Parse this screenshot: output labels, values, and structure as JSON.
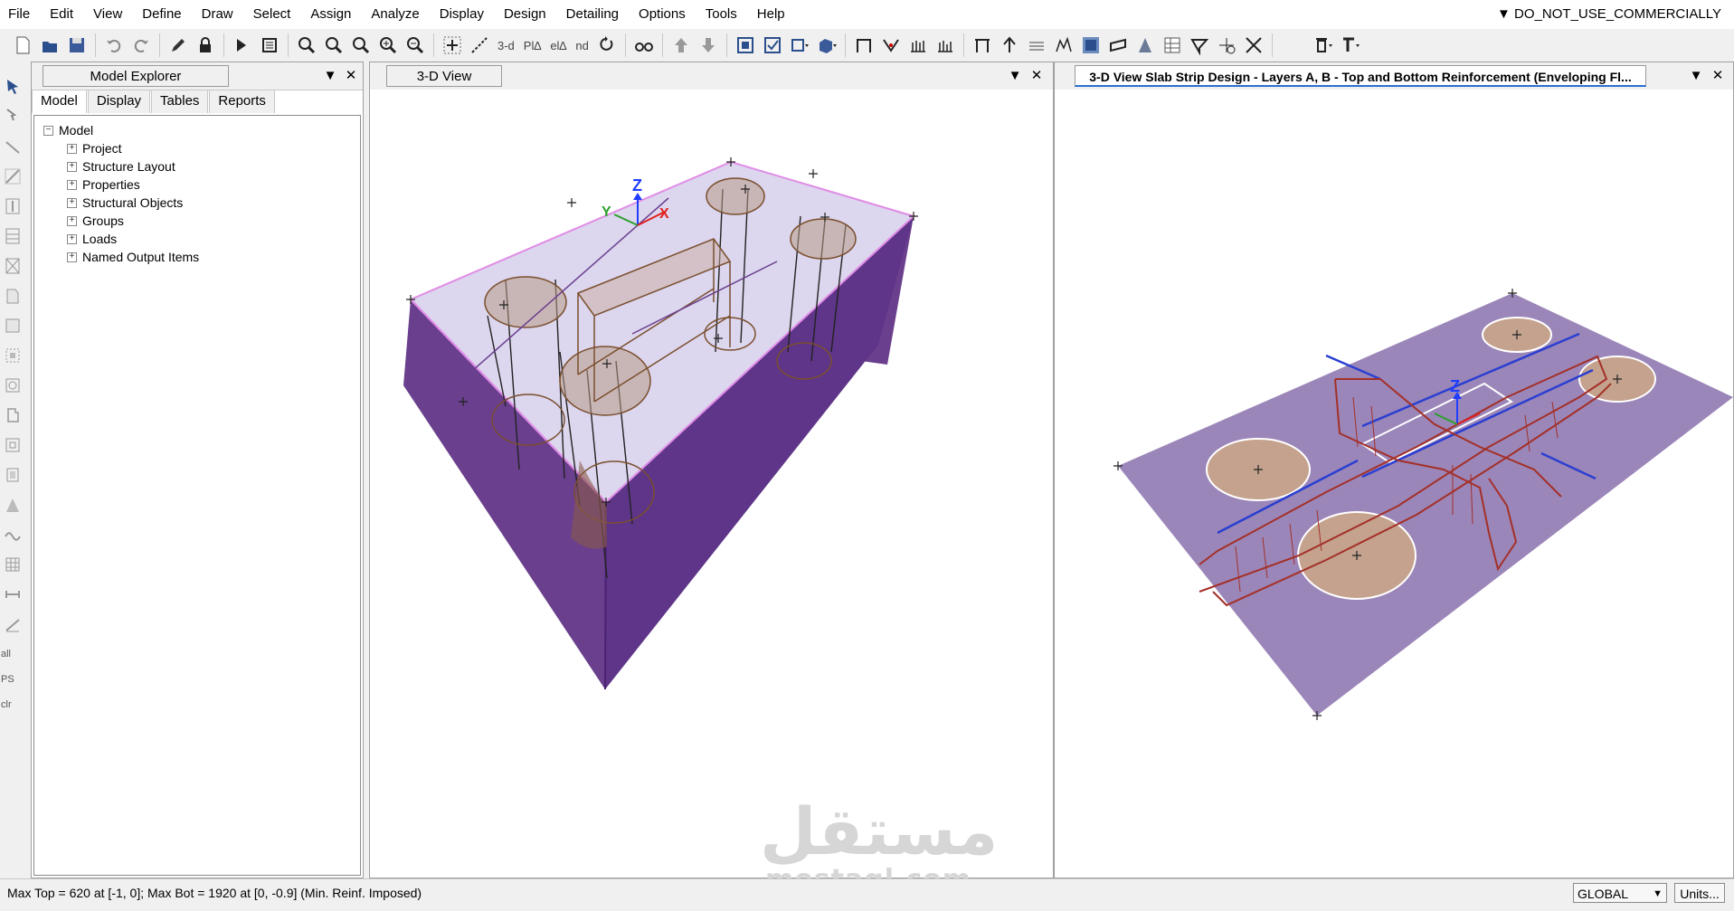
{
  "menu": {
    "items": [
      "File",
      "Edit",
      "View",
      "Define",
      "Draw",
      "Select",
      "Assign",
      "Analyze",
      "Display",
      "Design",
      "Detailing",
      "Options",
      "Tools",
      "Help"
    ],
    "license_note": "▼ DO_NOT_USE_COMMERCIALLY"
  },
  "toolbar": {
    "view_3d": "3-d",
    "view_plan": "Pl∆",
    "view_elev": "el∆",
    "view_nd": "nd"
  },
  "vtoolbar": {
    "all_label": "all",
    "ps_label": "PS",
    "clr_label": "clr"
  },
  "explorer": {
    "title": "Model Explorer",
    "tabs": [
      "Model",
      "Display",
      "Tables",
      "Reports"
    ],
    "root": "Model",
    "items": [
      "Project",
      "Structure Layout",
      "Properties",
      "Structural Objects",
      "Groups",
      "Loads",
      "Named Output Items"
    ]
  },
  "view1": {
    "title": "3-D View",
    "axis_z": "Z",
    "axis_y": "Y",
    "axis_x": "X"
  },
  "view2": {
    "title": "3-D View  Slab Strip Design - Layers A, B - Top and Bottom Reinforcement (Enveloping Fl...",
    "axis_z": "Z"
  },
  "status": {
    "text": "Max Top = 620 at [-1, 0];  Max Bot = 1920 at [0, -0.9]  (Min. Reinf. Imposed)",
    "coord_system": "GLOBAL",
    "units_button": "Units..."
  },
  "watermark": {
    "arabic": "مستقل",
    "latin": "mostaql.com"
  },
  "colors": {
    "slab_fill": "#9b86b9",
    "slab_side": "#6a3f8e",
    "slab_top": "#dcd6ee",
    "column_stroke": "#7a4f2e",
    "strip_red": "#a33028",
    "strip_blue": "#2a3fd1",
    "accent_tab": "#2a6fd0"
  }
}
